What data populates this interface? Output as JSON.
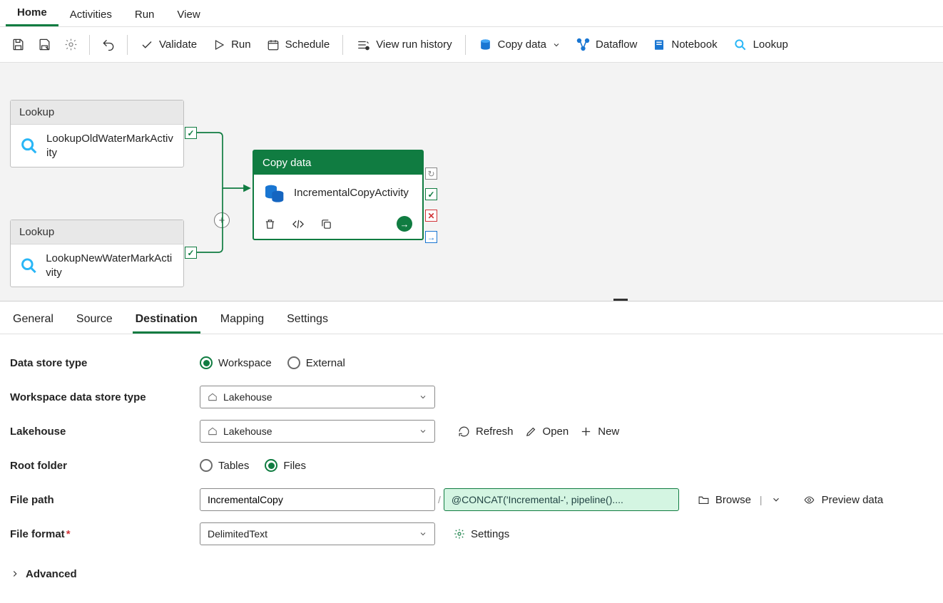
{
  "topTabs": {
    "home": "Home",
    "activities": "Activities",
    "run": "Run",
    "view": "View"
  },
  "toolbar": {
    "validate": "Validate",
    "run": "Run",
    "schedule": "Schedule",
    "viewHistory": "View run history",
    "copyData": "Copy data",
    "dataflow": "Dataflow",
    "notebook": "Notebook",
    "lookup": "Lookup"
  },
  "activities": {
    "lookup1": {
      "type": "Lookup",
      "name": "LookupOldWaterMarkActivity"
    },
    "lookup2": {
      "type": "Lookup",
      "name": "LookupNewWaterMarkActivity"
    },
    "copy": {
      "type": "Copy data",
      "name": "IncrementalCopyActivity"
    }
  },
  "propTabs": {
    "general": "General",
    "source": "Source",
    "destination": "Destination",
    "mapping": "Mapping",
    "settings": "Settings"
  },
  "form": {
    "dataStoreTypeLabel": "Data store type",
    "workspaceOpt": "Workspace",
    "externalOpt": "External",
    "wsDataStoreLabel": "Workspace data store type",
    "wsDataStoreVal": "Lakehouse",
    "lakehouseLabel": "Lakehouse",
    "lakehouseVal": "Lakehouse",
    "refresh": "Refresh",
    "open": "Open",
    "new": "New",
    "rootFolderLabel": "Root folder",
    "tablesOpt": "Tables",
    "filesOpt": "Files",
    "filePathLabel": "File path",
    "filePathDir": "IncrementalCopy",
    "filePathSep": "/",
    "filePathExpr": "@CONCAT('Incremental-', pipeline()....",
    "browse": "Browse",
    "previewData": "Preview data",
    "fileFormatLabel": "File format",
    "fileFormatVal": "DelimitedText",
    "settings": "Settings",
    "advanced": "Advanced"
  }
}
